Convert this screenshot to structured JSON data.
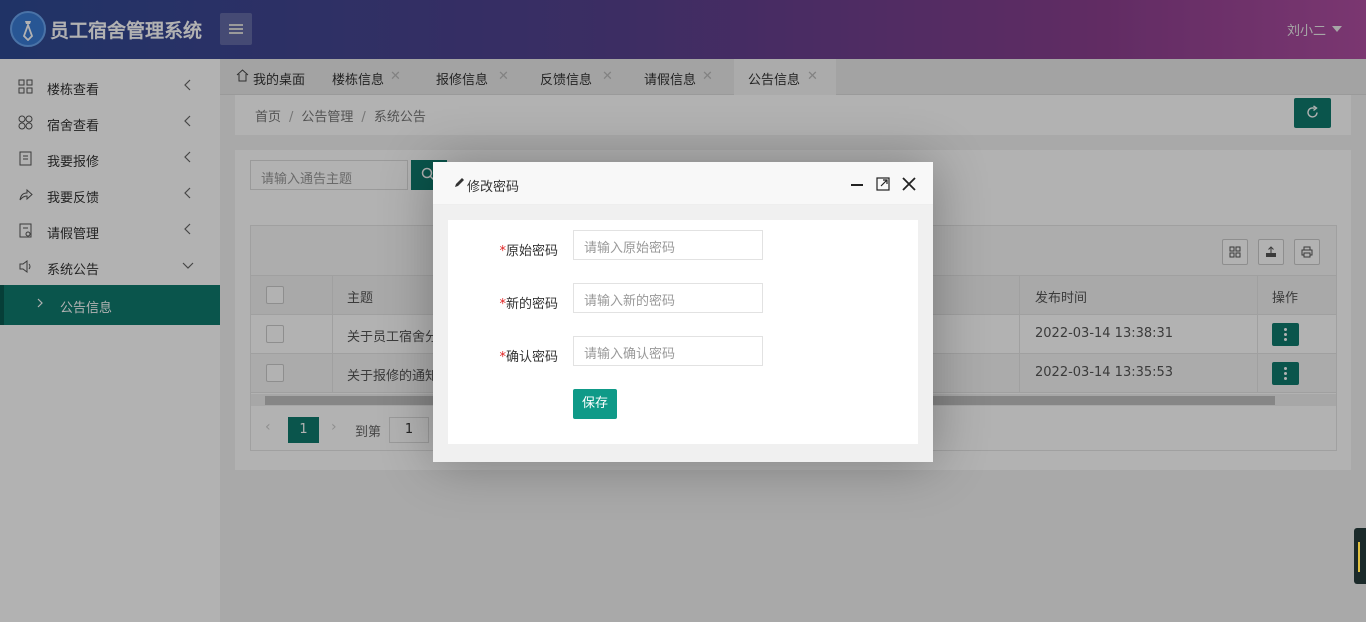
{
  "header": {
    "app_title": "员工宿舍管理系统",
    "user_name": "刘小二"
  },
  "sidebar": {
    "items": [
      {
        "label": "楼栋查看",
        "icon": "grid-icon"
      },
      {
        "label": "宿舍查看",
        "icon": "clover-icon"
      },
      {
        "label": "我要报修",
        "icon": "form-icon"
      },
      {
        "label": "我要反馈",
        "icon": "share-icon"
      },
      {
        "label": "请假管理",
        "icon": "document-icon"
      },
      {
        "label": "系统公告",
        "icon": "speaker-icon"
      }
    ],
    "sub_item": {
      "label": "公告信息"
    }
  },
  "tabs": [
    {
      "label": "我的桌面",
      "icon": "home-icon"
    },
    {
      "label": "楼栋信息"
    },
    {
      "label": "报修信息"
    },
    {
      "label": "反馈信息"
    },
    {
      "label": "请假信息"
    },
    {
      "label": "公告信息",
      "active": true
    }
  ],
  "breadcrumb": [
    "首页",
    "公告管理",
    "系统公告"
  ],
  "search": {
    "placeholder": "请输入通告主题"
  },
  "table": {
    "headers": {
      "title": "主题",
      "time": "发布时间",
      "action": "操作"
    },
    "rows": [
      {
        "title": "关于员工宿舍分",
        "time": "2022-03-14 13:38:31"
      },
      {
        "title": "关于报修的通知",
        "time": "2022-03-14 13:35:53"
      }
    ]
  },
  "pager": {
    "current": "1",
    "goto_label": "到第",
    "goto_value": "1"
  },
  "modal": {
    "title": "修改密码",
    "fields": [
      {
        "required_mark": "*",
        "label": "原始密码",
        "placeholder": "请输入原始密码"
      },
      {
        "required_mark": "*",
        "label": "新的密码",
        "placeholder": "请输入新的密码"
      },
      {
        "required_mark": "*",
        "label": "确认密码",
        "placeholder": "请输入确认密码"
      }
    ],
    "save_label": "保存"
  },
  "colors": {
    "accent": "#0f7a6e",
    "save_button": "#0f9a88",
    "required": "#e02020"
  }
}
